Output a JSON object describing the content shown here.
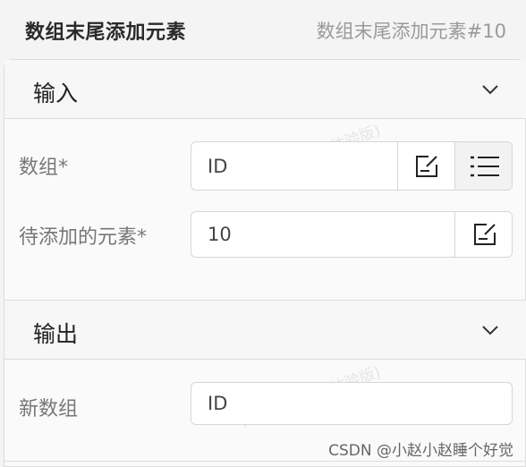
{
  "header": {
    "title": "数组末尾添加元素",
    "subtitle": "数组末尾添加元素#10"
  },
  "input_section": {
    "title": "输入",
    "fields": [
      {
        "label": "数组*",
        "value": "ID"
      },
      {
        "label": "待添加的元素*",
        "value": "10"
      }
    ]
  },
  "output_section": {
    "title": "输出",
    "fields": [
      {
        "label": "新数组",
        "value": "ID"
      }
    ]
  },
  "watermark": "弘玑Cyclone(体验版)",
  "footer_credit": "CSDN @小赵小赵睡个好觉",
  "icons": {
    "collapse": "chevron-down-icon",
    "edit": "edit-icon",
    "list": "list-icon"
  }
}
